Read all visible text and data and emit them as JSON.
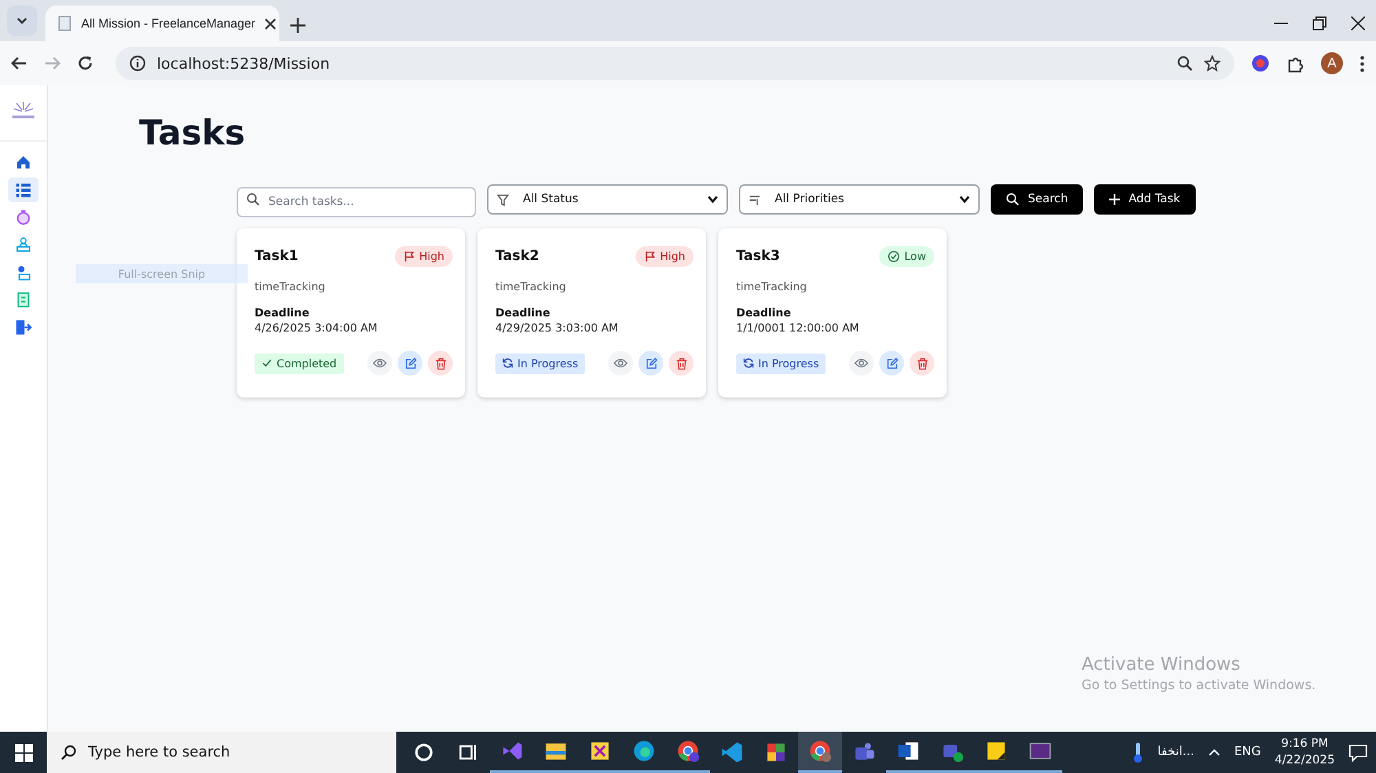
{
  "browser": {
    "tab_title": "All Mission - FreelanceManager",
    "url": "localhost:5238/Mission",
    "back_disabled": false,
    "forward_disabled": true,
    "avatar_letter": "A"
  },
  "sidebar": {
    "items": [
      {
        "kind": "home",
        "selected": false
      },
      {
        "kind": "list",
        "selected": true
      },
      {
        "kind": "timer",
        "selected": false
      },
      {
        "kind": "team",
        "selected": false
      },
      {
        "kind": "profile",
        "selected": false
      },
      {
        "kind": "document",
        "selected": false
      },
      {
        "kind": "logout",
        "selected": false
      }
    ]
  },
  "page_title": "Tasks",
  "toolbar": {
    "search_placeholder": "Search tasks...",
    "status_filter": "All Status",
    "priority_filter": "All Priorities",
    "search_button": "Search",
    "add_button": "Add Task"
  },
  "tasks": [
    {
      "title": "Task1",
      "priority": {
        "text": "High",
        "kind": "high"
      },
      "category": "timeTracking",
      "deadline_label": "Deadline",
      "deadline": "4/26/2025 3:04:00 AM",
      "status": {
        "text": "Completed",
        "kind": "completed"
      }
    },
    {
      "title": "Task2",
      "priority": {
        "text": "High",
        "kind": "high"
      },
      "category": "timeTracking",
      "deadline_label": "Deadline",
      "deadline": "4/29/2025 3:03:00 AM",
      "status": {
        "text": "In Progress",
        "kind": "in-progress"
      }
    },
    {
      "title": "Task3",
      "priority": {
        "text": "Low",
        "kind": "low"
      },
      "category": "timeTracking",
      "deadline_label": "Deadline",
      "deadline": "1/1/0001 12:00:00 AM",
      "status": {
        "text": "In Progress",
        "kind": "in-progress"
      }
    }
  ],
  "snip_tooltip": "Full-screen Snip",
  "activation_notice": {
    "title": "Activate Windows",
    "subtitle": "Go to Settings to activate Windows."
  },
  "taskbar": {
    "search_placeholder": "Type here to search",
    "apps": [
      {
        "kind": "cortana",
        "running": false,
        "active": false
      },
      {
        "kind": "task-view",
        "running": false,
        "active": false
      },
      {
        "kind": "visual-studio",
        "running": true,
        "active": false
      },
      {
        "kind": "file-explorer",
        "running": true,
        "active": false
      },
      {
        "kind": "tool",
        "running": true,
        "active": false
      },
      {
        "kind": "edge",
        "running": true,
        "active": false
      },
      {
        "kind": "chrome-profile",
        "running": true,
        "active": false
      },
      {
        "kind": "vscode",
        "running": false,
        "active": false
      },
      {
        "kind": "squares",
        "running": false,
        "active": false
      },
      {
        "kind": "chrome",
        "running": true,
        "active": true
      },
      {
        "kind": "teams",
        "running": false,
        "active": false
      },
      {
        "kind": "word",
        "running": true,
        "active": false
      },
      {
        "kind": "teams-check",
        "running": true,
        "active": false
      },
      {
        "kind": "sticky-notes",
        "running": true,
        "active": false
      },
      {
        "kind": "terminal",
        "running": true,
        "active": false
      }
    ],
    "weather": "انخفا...",
    "language": "ENG",
    "time": "9:16 PM",
    "date": "4/22/2025"
  }
}
